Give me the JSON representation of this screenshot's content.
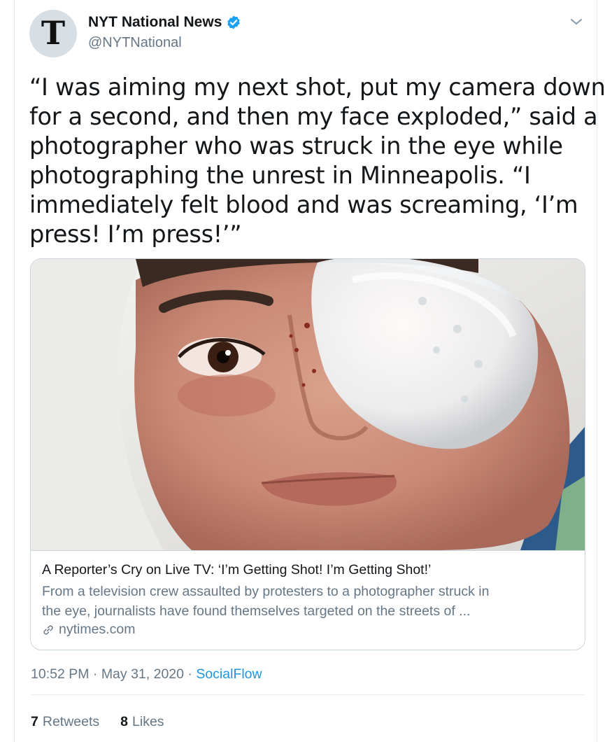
{
  "tweet": {
    "author": {
      "name": "NYT National News",
      "handle": "@NYTNational",
      "avatar_glyph": "T",
      "verified": true
    },
    "text_lines": [
      "“I was aiming my next shot, put my camera down",
      "for a second, and then my face exploded,” said a",
      "photographer who was struck in the eye while",
      "photographing the unrest in Minneapolis.  “I",
      "immediately felt blood and was screaming, ‘I’m",
      "press! I’m press!’”"
    ],
    "link_card": {
      "title": "A Reporter’s Cry on Live TV: ‘I’m Getting Shot! I’m Getting Shot!’",
      "description_lines": [
        "From a television crew assaulted by protesters to a photographer struck in",
        "the eye, journalists have found themselves targeted on the streets of ..."
      ],
      "domain": "nytimes.com"
    },
    "time": "10:52 PM",
    "date": "May 31, 2020",
    "separator": "·",
    "source": "SocialFlow",
    "stats": {
      "retweets_count": "7",
      "retweets_label": "Retweets",
      "likes_count": "8",
      "likes_label": "Likes"
    }
  },
  "colors": {
    "primary_text": "#14171a",
    "secondary_text": "#657786",
    "link_blue": "#1b95e0",
    "verified_blue": "#1da1f2",
    "border": "#ccd6dd"
  },
  "icons": [
    "verified-badge-icon",
    "chevron-down-icon",
    "link-icon"
  ]
}
